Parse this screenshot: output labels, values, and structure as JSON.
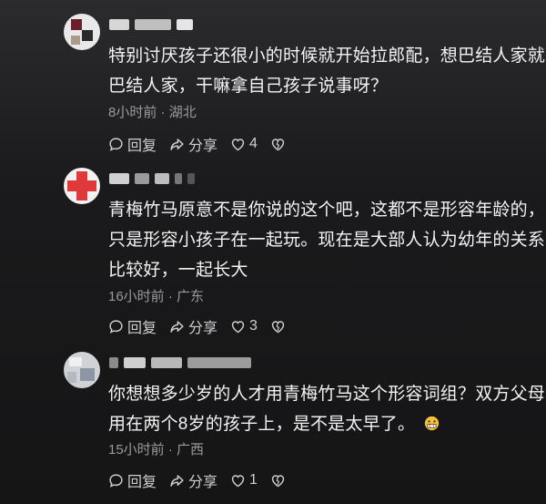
{
  "comments": [
    {
      "text_line1": "特别讨厌孩子还很小的时候就开始拉郎配，想巴结人家就",
      "text_line2": "巴结人家，干嘛拿自己孩子说事呀？",
      "time": "8小时前",
      "location": "湖北",
      "reply_label": "回复",
      "share_label": "分享",
      "like_count": "4"
    },
    {
      "text_line1": "青梅竹马原意不是你说的这个吧，这都不是形容年龄的，",
      "text_line2": "只是形容小孩子在一起玩。现在是大部人认为幼年的关系",
      "text_line3": "比较好，一起长大",
      "time": "16小时前",
      "location": "广东",
      "reply_label": "回复",
      "share_label": "分享",
      "like_count": "3"
    },
    {
      "text_line1": "你想想多少岁的人才用青梅竹马这个形容词组？双方父母",
      "text_line2": "用在两个8岁的孩子上，是不是太早了。",
      "time": "15小时前",
      "location": "广西",
      "reply_label": "回复",
      "share_label": "分享",
      "like_count": "1"
    }
  ],
  "icons": {
    "reply": "comment-bubble-icon",
    "share": "share-arrow-icon",
    "like": "heart-icon",
    "dislike": "broken-heart-icon",
    "emoji": "grimace-emoji-icon"
  },
  "colors": {
    "background": "#1a1a1c",
    "text": "#f3f3f3",
    "meta": "#9a9a9a",
    "avatar_red": "#e0393a"
  }
}
